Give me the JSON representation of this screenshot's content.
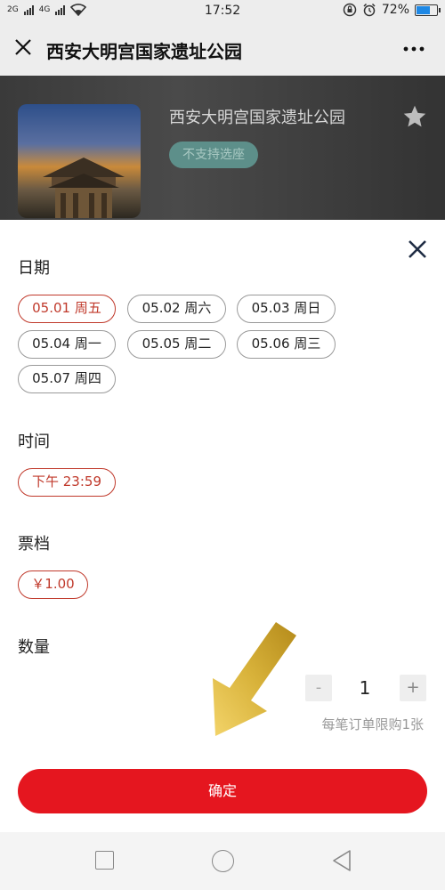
{
  "status_bar": {
    "network_left": "2G",
    "network_right": "4G",
    "time": "17:52",
    "battery": "72%",
    "battery_level": 0.72
  },
  "header": {
    "close_icon": "close-icon",
    "title": "西安大明宫国家遗址公园",
    "more_icon": "more-icon"
  },
  "hero": {
    "venue_name": "西安大明宫国家遗址公园",
    "badge": "不支持选座",
    "favorite_icon": "star-icon"
  },
  "sheet": {
    "date_title": "日期",
    "dates": [
      "05.01 周五",
      "05.02 周六",
      "05.03 周日",
      "05.04 周一",
      "05.05 周二",
      "05.06 周三",
      "05.07 周四"
    ],
    "selected_date": "05.01 周五",
    "time_title": "时间",
    "time_option": "下午 23:59",
    "ticket_title": "票档",
    "ticket_option": "￥1.00",
    "quantity_title": "数量",
    "qty_minus": "-",
    "qty_value": "1",
    "qty_plus": "+",
    "limit_text": "每笔订单限购1张",
    "confirm_label": "确定"
  },
  "colors": {
    "accent": "#e5161f",
    "selected_border": "#c0392b",
    "badge_bg": "#5d8f8a"
  }
}
